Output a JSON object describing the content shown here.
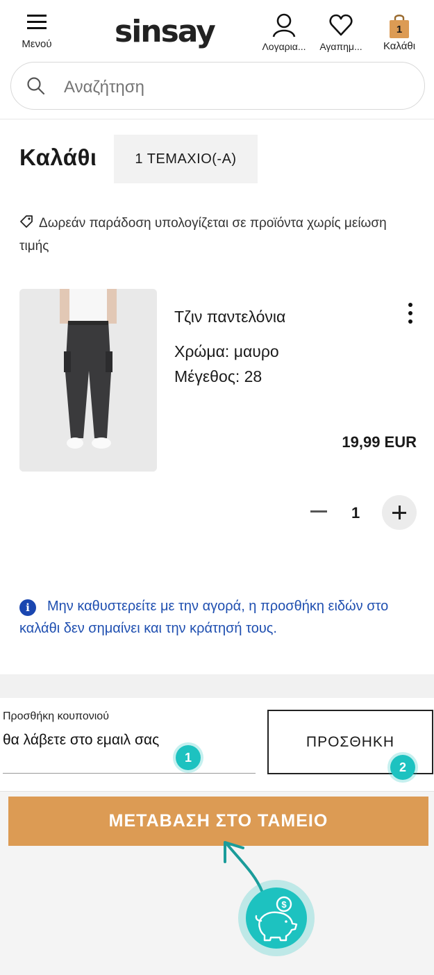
{
  "header": {
    "menu_label": "Μενού",
    "brand": "sinsay",
    "account_label": "Λογαρια...",
    "favorites_label": "Αγαπημ...",
    "cart_label": "Καλάθι",
    "cart_count": "1"
  },
  "search": {
    "placeholder": "Αναζήτηση"
  },
  "cart": {
    "title": "Καλάθι",
    "items_count": "1 ΤΕΜΑΧΙΟ(-Α)",
    "delivery_note": "Δωρεάν παράδοση υπολογίζεται σε προϊόντα χωρίς μείωση τιμής"
  },
  "product": {
    "name": "Τζιν παντελόνια",
    "color": "Χρώμα: μαυρο",
    "size": "Μέγεθος: 28",
    "price": "19,99 EUR",
    "quantity": "1"
  },
  "info_note": "Μην καθυστερείτε με την αγορά, η προσθήκη ειδών στο καλάθι δεν σημαίνει και την κράτησή τους.",
  "coupon": {
    "label": "Προσθήκη κουπονιού",
    "value": "θα λάβετε στο εμαιλ σας",
    "add_button": "ΠΡΟΣΘΗΚΗ"
  },
  "steps": {
    "one": "1",
    "two": "2"
  },
  "checkout_button": "ΜΕΤΑΒΑΣΗ ΣΤΟ ΤΑΜΕΙΟ",
  "colors": {
    "accent": "#dc9b54",
    "teal": "#1dc2c0",
    "info_blue": "#1f4fb0"
  }
}
